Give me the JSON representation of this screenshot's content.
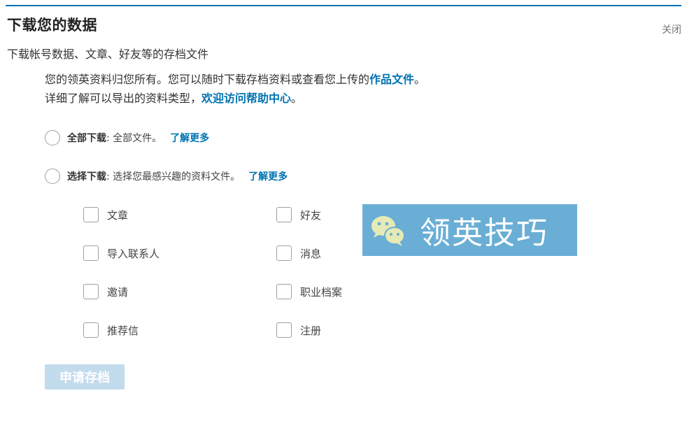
{
  "header": {
    "title": "下载您的数据",
    "close_label": "关闭",
    "subtitle": "下载帐号数据、文章、好友等的存档文件"
  },
  "intro": {
    "line1_text": "您的领英资料归您所有。您可以随时下载存档资料或查看您上传的",
    "line1_link": "作品文件",
    "line1_end": "。",
    "line2_text": "详细了解可以导出的资料类型，",
    "line2_link": "欢迎访问帮助中心",
    "line2_end": "。"
  },
  "options": [
    {
      "label": "全部下载",
      "desc": ": 全部文件。",
      "more": "了解更多",
      "selected": false
    },
    {
      "label": "选择下载",
      "desc": ": 选择您最感兴趣的资料文件。",
      "more": "了解更多",
      "selected": false
    }
  ],
  "checkboxes": {
    "left": [
      {
        "label": "文章",
        "checked": false
      },
      {
        "label": "导入联系人",
        "checked": false
      },
      {
        "label": "邀请",
        "checked": false
      },
      {
        "label": "推荐信",
        "checked": false
      }
    ],
    "right": [
      {
        "label": "好友",
        "checked": false
      },
      {
        "label": "消息",
        "checked": false
      },
      {
        "label": "职业档案",
        "checked": false
      },
      {
        "label": "注册",
        "checked": false
      }
    ]
  },
  "watermark": {
    "text": "领英技巧",
    "icon": "wechat-icon"
  },
  "submit_label": "申请存档",
  "colors": {
    "accent": "#0073b1",
    "button_disabled": "#c2dbed",
    "watermark_bg": "#6aaed6"
  }
}
